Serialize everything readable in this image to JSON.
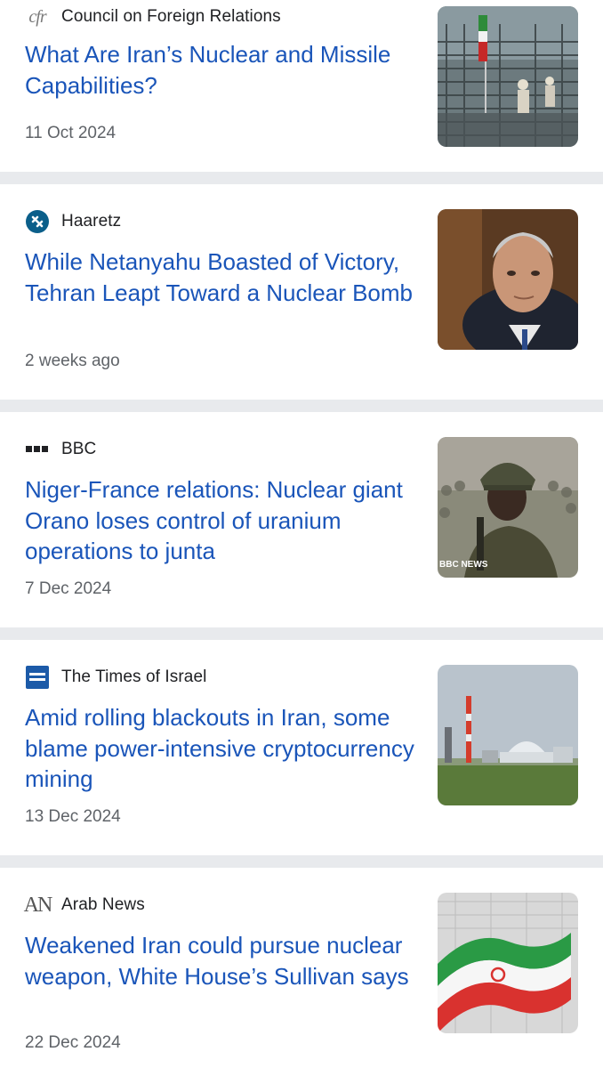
{
  "articles": [
    {
      "source": "Council on Foreign Relations",
      "logo_icon": "cfr-logo-icon",
      "logo_text": "cfr",
      "headline": "What Are Iran’s Nuclear and Missile Capabilities?",
      "date": "11 Oct 2024",
      "image": "iran-nuclear-facility-workers-photo"
    },
    {
      "source": "Haaretz",
      "logo_icon": "haaretz-logo-icon",
      "headline": "While Netanyahu Boasted of Victory, Tehran Leapt Toward a Nuclear Bomb",
      "date": "2 weeks ago",
      "image": "netanyahu-portrait-photo"
    },
    {
      "source": "BBC",
      "logo_icon": "bbc-logo-icon",
      "headline": "Niger-France relations: Nuclear giant Orano loses control of uranium operations to junta",
      "date": "7 Dec 2024",
      "image": "soldier-in-crowd-photo",
      "image_watermark": "BBC NEWS"
    },
    {
      "source": "The Times of Israel",
      "logo_icon": "times-of-israel-logo-icon",
      "headline": "Amid rolling blackouts in Iran, some blame power-intensive cryptocurrency mining",
      "date": "13 Dec 2024",
      "image": "bushehr-power-plant-photo"
    },
    {
      "source": "Arab News",
      "logo_icon": "arab-news-logo-icon",
      "logo_text": "AN",
      "headline": "Weakened Iran could pursue nuclear weapon, White House’s Sullivan says",
      "date": "22 Dec 2024",
      "image": "iran-flag-photo"
    }
  ],
  "colors": {
    "headline": "#1a55b9",
    "source": "#202124",
    "date": "#5f6368",
    "separator": "#e8eaed"
  }
}
